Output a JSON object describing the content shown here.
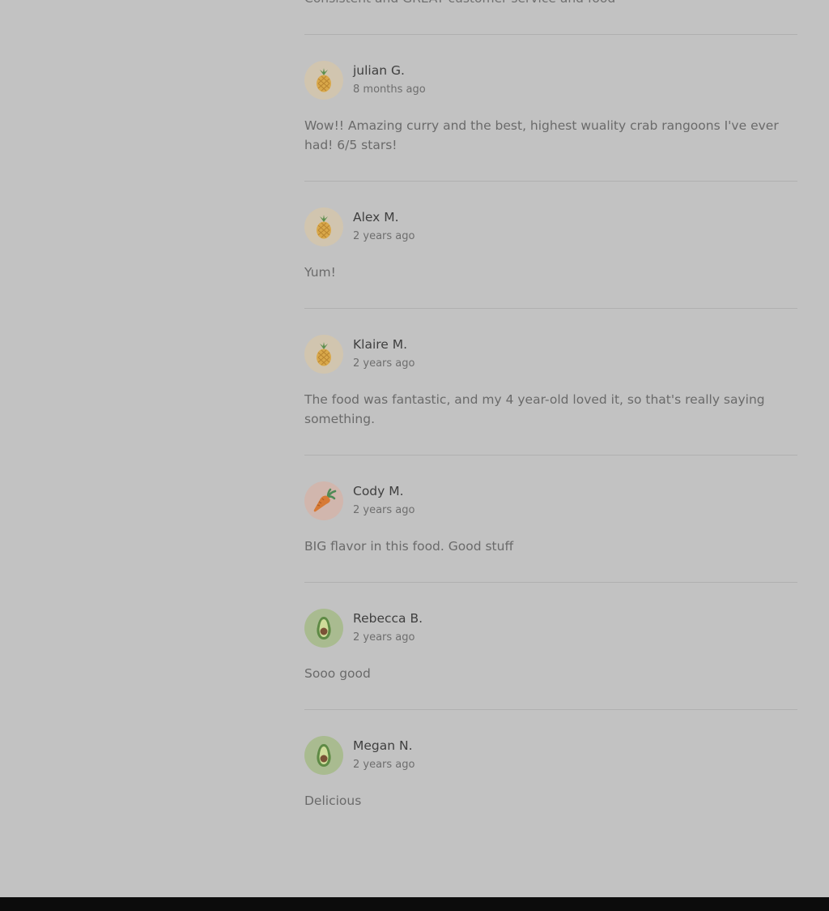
{
  "cutoff_text": "Consistent and GREAT customer service and food",
  "reviews": [
    {
      "name": "julian G.",
      "time": "8 months ago",
      "text": "Wow!! Amazing curry and the best, highest wuality crab rangoons I've ever had! 6/5 stars!",
      "avatar": "pineapple-icon"
    },
    {
      "name": "Alex M.",
      "time": "2 years ago",
      "text": "Yum!",
      "avatar": "pineapple-icon"
    },
    {
      "name": "Klaire M.",
      "time": "2 years ago",
      "text": "The food was fantastic, and my 4 year-old loved it, so that's really saying something.",
      "avatar": "pineapple-icon"
    },
    {
      "name": "Cody M.",
      "time": "2 years ago",
      "text": "BIG flavor in this food. Good stuff",
      "avatar": "carrot-icon"
    },
    {
      "name": "Rebecca B.",
      "time": "2 years ago",
      "text": "Sooo good",
      "avatar": "avocado-icon"
    },
    {
      "name": "Megan N.",
      "time": "2 years ago",
      "text": "Delicious",
      "avatar": "avocado-icon"
    }
  ],
  "colors": {
    "backdrop": "#c2c2c2",
    "pineapple_bg": "#d1c5af",
    "carrot_bg": "#d1b6ad",
    "avocado_bg": "#a9bb90",
    "footer": "#0c0c0c"
  }
}
